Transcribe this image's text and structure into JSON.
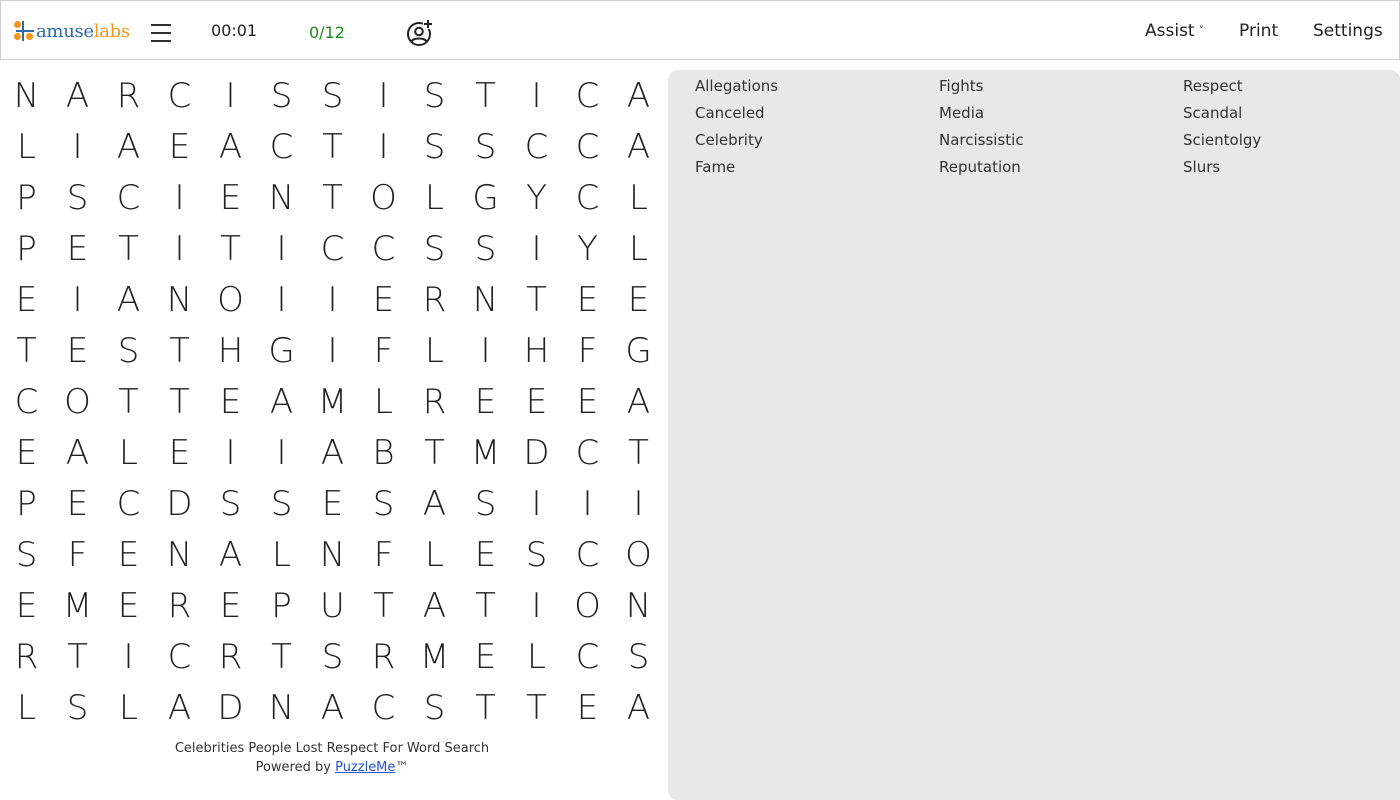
{
  "header": {
    "logo": {
      "part1": "amuse",
      "part2": "labs"
    },
    "menu_icon": "hamburger-menu-icon",
    "timer": "00:01",
    "progress": "0/12",
    "add_user_icon": "add-user-icon",
    "nav": {
      "assist": "Assist",
      "assist_chevron": "˅",
      "print": "Print",
      "settings": "Settings"
    }
  },
  "grid": [
    [
      "N",
      "A",
      "R",
      "C",
      "I",
      "S",
      "S",
      "I",
      "S",
      "T",
      "I",
      "C",
      "A"
    ],
    [
      "L",
      "I",
      "A",
      "E",
      "A",
      "C",
      "T",
      "I",
      "S",
      "S",
      "C",
      "C",
      "A"
    ],
    [
      "P",
      "S",
      "C",
      "I",
      "E",
      "N",
      "T",
      "O",
      "L",
      "G",
      "Y",
      "C",
      "L"
    ],
    [
      "P",
      "E",
      "T",
      "I",
      "T",
      "I",
      "C",
      "C",
      "S",
      "S",
      "I",
      "Y",
      "L"
    ],
    [
      "E",
      "I",
      "A",
      "N",
      "O",
      "I",
      "I",
      "E",
      "R",
      "N",
      "T",
      "E",
      "E"
    ],
    [
      "T",
      "E",
      "S",
      "T",
      "H",
      "G",
      "I",
      "F",
      "L",
      "I",
      "H",
      "F",
      "G"
    ],
    [
      "C",
      "O",
      "T",
      "T",
      "E",
      "A",
      "M",
      "L",
      "R",
      "E",
      "E",
      "E",
      "A"
    ],
    [
      "E",
      "A",
      "L",
      "E",
      "I",
      "I",
      "A",
      "B",
      "T",
      "M",
      "D",
      "C",
      "T"
    ],
    [
      "P",
      "E",
      "C",
      "D",
      "S",
      "S",
      "E",
      "S",
      "A",
      "S",
      "I",
      "I",
      "I"
    ],
    [
      "S",
      "F",
      "E",
      "N",
      "A",
      "L",
      "N",
      "F",
      "L",
      "E",
      "S",
      "C",
      "O"
    ],
    [
      "E",
      "M",
      "E",
      "R",
      "E",
      "P",
      "U",
      "T",
      "A",
      "T",
      "I",
      "O",
      "N"
    ],
    [
      "R",
      "T",
      "I",
      "C",
      "R",
      "T",
      "S",
      "R",
      "M",
      "E",
      "L",
      "C",
      "S"
    ],
    [
      "L",
      "S",
      "L",
      "A",
      "D",
      "N",
      "A",
      "C",
      "S",
      "T",
      "T",
      "E",
      "A"
    ]
  ],
  "footer": {
    "title": "Celebrities People Lost Respect For Word Search",
    "powered_by": "Powered by ",
    "link": "PuzzleMe",
    "tm": "™"
  },
  "words": [
    "Allegations",
    "Canceled",
    "Celebrity",
    "Fame",
    "Fights",
    "Media",
    "Narcissistic",
    "Reputation",
    "Respect",
    "Scandal",
    "Scientolgy",
    "Slurs"
  ],
  "colors": {
    "logo_blue": "#2a6aa8",
    "logo_orange": "#f7941d",
    "progress_green": "#1d8a1d",
    "link_blue": "#2255cc",
    "wordlist_bg": "#e8e8e8"
  }
}
